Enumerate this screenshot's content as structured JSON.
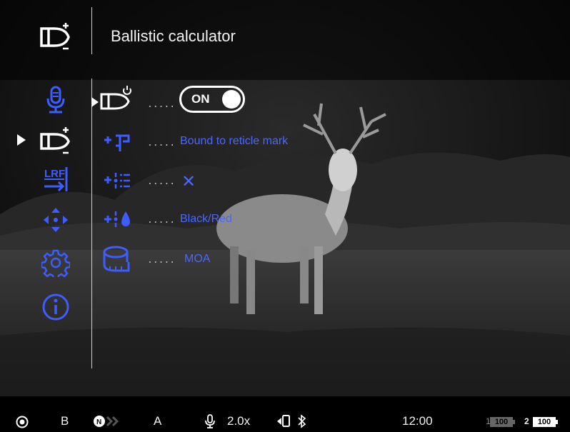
{
  "header": {
    "title": "Ballistic calculator",
    "icon": "bullet-plus-icon"
  },
  "sidebar": {
    "items": [
      {
        "name": "microphone",
        "icon": "microphone-icon"
      },
      {
        "name": "ballistic",
        "icon": "bullet-plus-icon",
        "selected": true
      },
      {
        "name": "lrf",
        "icon": "lrf-icon",
        "text": "LRF"
      },
      {
        "name": "zeroing",
        "icon": "crosshair-arrows-icon"
      },
      {
        "name": "settings",
        "icon": "gear-icon"
      },
      {
        "name": "info",
        "icon": "info-icon"
      }
    ]
  },
  "submenu": {
    "rows": [
      {
        "name": "ballistics-power",
        "icon": "bullet-power-icon",
        "toggle_label": "ON",
        "toggle_on": true,
        "selected": true
      },
      {
        "name": "reticle-binding",
        "icon": "reticle-bound-icon",
        "value": "Bound to reticle mark"
      },
      {
        "name": "reticle-list",
        "icon": "reticle-list-icon",
        "value": "✕"
      },
      {
        "name": "reticle-color",
        "icon": "reticle-color-icon",
        "value": "Black/Red"
      },
      {
        "name": "units",
        "icon": "tape-measure-icon",
        "value": "MOA"
      }
    ],
    "dots": "....."
  },
  "statusbar": {
    "record_icon": "record-icon",
    "mode": "B",
    "mode2": "A",
    "zoom": "2.0x",
    "time": "12:00",
    "battery1_label": "1",
    "battery1_value": "100",
    "battery2_label": "2",
    "battery2_value": "100"
  },
  "colors": {
    "accent": "#3d5dff",
    "text": "#ffffff",
    "background": "#000000"
  }
}
